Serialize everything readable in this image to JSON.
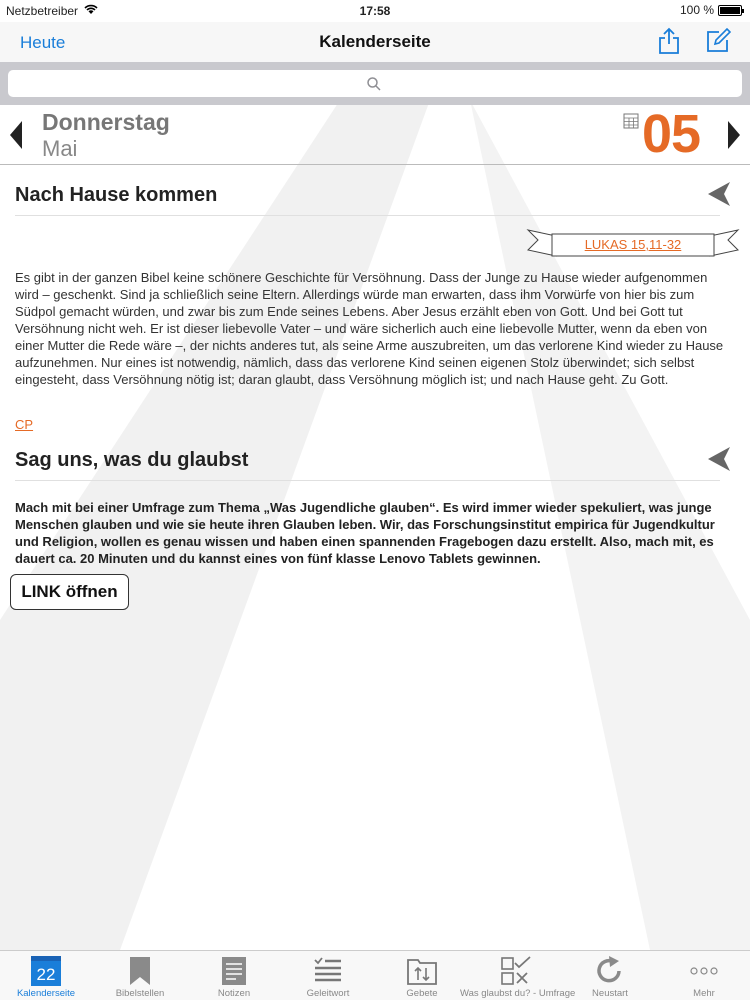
{
  "status_bar": {
    "carrier": "Netzbetreiber",
    "time": "17:58",
    "battery": "100 %",
    "battery_level": 1.0
  },
  "nav": {
    "back_label": "Heute",
    "title": "Kalenderseite"
  },
  "date": {
    "weekday": "Donnerstag",
    "month": "Mai",
    "day": "05"
  },
  "colors": {
    "accent": "#e56a26",
    "ios_blue": "#1a7ed9"
  },
  "section1": {
    "title": "Nach Hause kommen",
    "reference": "LUKAS 15,11-32",
    "body": "Es gibt in der ganzen Bibel keine schönere Geschichte für Versöhnung. Dass der Junge zu Hause wieder aufgenommen wird – geschenkt. Sind ja schließlich seine Eltern. Allerdings würde man erwarten, dass ihm Vorwürfe von hier bis zum Südpol gemacht würden, und zwar bis zum Ende seines Lebens. Aber Jesus erzählt eben von Gott. Und bei Gott tut Versöhnung nicht weh. Er ist dieser liebevolle Vater – und wäre sicherlich auch eine liebevolle Mutter, wenn da eben von einer Mutter die Rede wäre –, der nichts anderes tut, als seine Arme auszubreiten, um das verlorene Kind wieder zu Hause aufzunehmen. Nur eines ist notwendig, nämlich, dass das verlorene Kind seinen eigenen Stolz überwindet; sich selbst eingesteht, dass Versöhnung nötig ist; daran glaubt, dass Versöhnung möglich ist; und nach Hause geht. Zu Gott.",
    "author": "CP"
  },
  "section2": {
    "title": "Sag uns, was du glaubst",
    "body": "Mach mit bei einer Umfrage zum Thema „Was Jugendliche glauben“. Es wird immer wieder spekuliert, was junge Menschen glauben und wie sie heute ihren Glauben leben. Wir, das Forschungsinstitut empirica für Jugendkultur und Religion, wollen es genau wissen und haben einen spannenden Fragebogen dazu erstellt. Also, mach mit, es dauert ca. 20 Minuten und du kannst eines von fünf klasse Lenovo Tablets gewinnen.",
    "button_label": "LINK öffnen"
  },
  "tabs": [
    {
      "label": "Kalenderseite",
      "icon": "calendar-icon",
      "badge": "22",
      "active": true
    },
    {
      "label": "Bibelstellen",
      "icon": "bookmark-icon"
    },
    {
      "label": "Notizen",
      "icon": "notes-icon"
    },
    {
      "label": "Geleitwort",
      "icon": "list-icon"
    },
    {
      "label": "Gebete",
      "icon": "sort-icon"
    },
    {
      "label": "Was glaubst du? - Umfrage",
      "icon": "checklist-icon"
    },
    {
      "label": "Neustart",
      "icon": "refresh-icon"
    },
    {
      "label": "Mehr",
      "icon": "more-icon"
    }
  ]
}
